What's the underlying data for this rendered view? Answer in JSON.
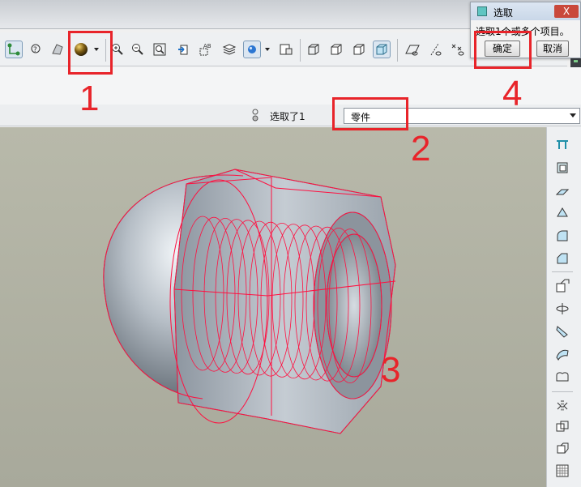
{
  "dialog": {
    "title": "选取",
    "close_label": "X",
    "message": "选取1个或多个项目。",
    "ok_label": "确定",
    "cancel_label": "取消"
  },
  "status": {
    "selected_text": "选取了1",
    "filter_value": "零件"
  },
  "callouts": [
    "1",
    "2",
    "3",
    "4"
  ],
  "colors": {
    "callout": "#e8242a",
    "viewport": "#b0b1a2",
    "edge_highlight": "#ff1040",
    "part": "#a9b1ba"
  },
  "toolbar_icons": [
    "select-icon",
    "query-select-icon",
    "fit-icon",
    "appearance-sphere-icon",
    "dropdown-arrow-icon",
    "zoom-in-icon",
    "zoom-out-icon",
    "zoom-fit-icon",
    "reorient-icon",
    "annotation-icon",
    "layers-icon",
    "datum-display-icon",
    "dropdown-arrow-icon",
    "view-manager-icon",
    "wireframe-icon",
    "hidden-line-icon",
    "no-hidden-icon",
    "shaded-icon",
    "datum-plane-icon",
    "datum-axis-icon",
    "datum-point-icon"
  ],
  "sidebar_icons": [
    "extrude-icon",
    "revolve-icon",
    "variable-section-sweep-icon",
    "hole-icon",
    "round-icon",
    "chamfer-icon",
    "shell-icon",
    "rib-icon",
    "draft-icon",
    "pattern-icon",
    "mirror-icon",
    "merge-icon",
    "intersect-icon",
    "offset-icon",
    "grid-icon"
  ]
}
